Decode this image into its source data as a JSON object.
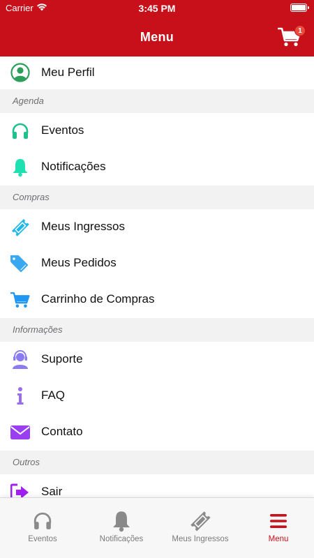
{
  "status": {
    "carrier": "Carrier",
    "time": "3:45 PM"
  },
  "header": {
    "title": "Menu",
    "cart_badge": "1"
  },
  "profile": {
    "label": "Meu Perfil"
  },
  "sections": {
    "agenda": "Agenda",
    "compras": "Compras",
    "informacoes": "Informações",
    "outros": "Outros"
  },
  "items": {
    "eventos": "Eventos",
    "notificacoes": "Notificações",
    "meus_ingressos": "Meus Ingressos",
    "meus_pedidos": "Meus Pedidos",
    "carrinho": "Carrinho de Compras",
    "suporte": "Suporte",
    "faq": "FAQ",
    "contato": "Contato",
    "sair": "Sair"
  },
  "tabs": [
    {
      "label": "Eventos",
      "icon": "headphones-icon"
    },
    {
      "label": "Notificações",
      "icon": "bell-icon"
    },
    {
      "label": "Meus Ingressos",
      "icon": "ticket-icon"
    },
    {
      "label": "Menu",
      "icon": "menu-icon",
      "active": true
    }
  ],
  "colors": {
    "brand": "#c8101b",
    "profile": "#2e9e5b",
    "eventos": "#1fc08e",
    "notificacoes": "#1ee0b0",
    "ingressos": "#1fb6e8",
    "pedidos": "#3aa8f0",
    "carrinho": "#2196f3",
    "suporte": "#8a7cf0",
    "faq": "#9a6cf0",
    "contato": "#9a3ff0",
    "sair": "#a020f0",
    "tab_inactive": "#8a8a8a"
  }
}
